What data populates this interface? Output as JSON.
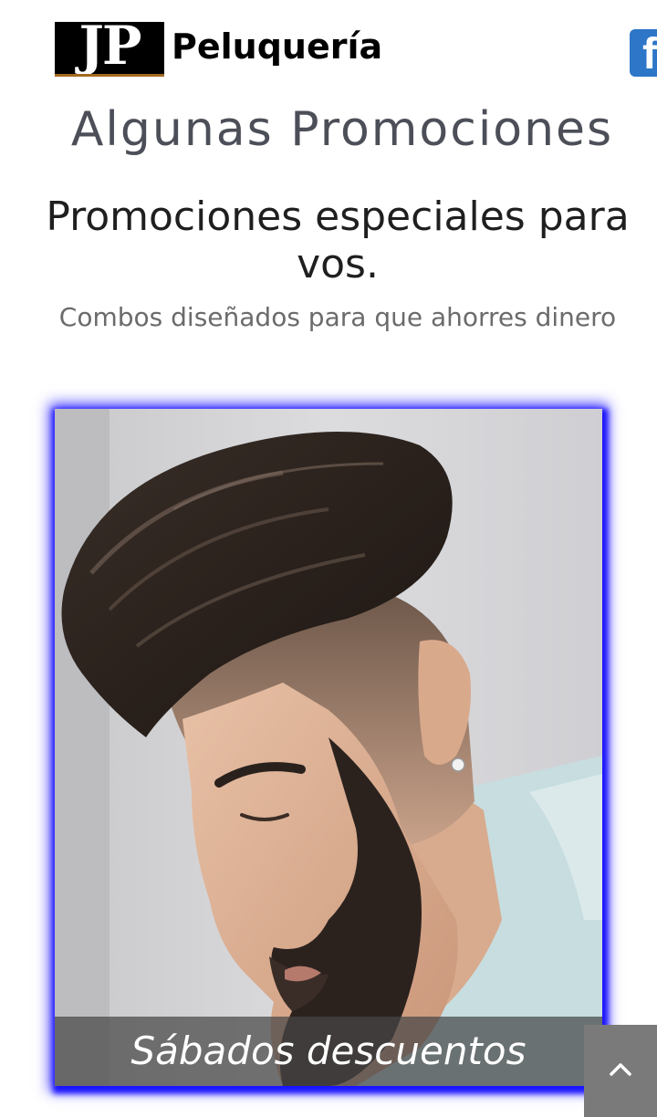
{
  "header": {
    "logo_text": "JP",
    "brand_name": "Peluquería",
    "social_icon": "facebook-icon"
  },
  "main": {
    "title": "Algunas Promociones",
    "subtitle": "Promociones especiales para vos.",
    "tagline": "Combos diseñados para que ahorres dinero"
  },
  "promo": {
    "caption": "Sábados descuentos",
    "glow_color": "#1a14ff"
  },
  "ui": {
    "back_to_top_icon": "chevron-up-icon",
    "facebook_color": "#2d76c8"
  }
}
